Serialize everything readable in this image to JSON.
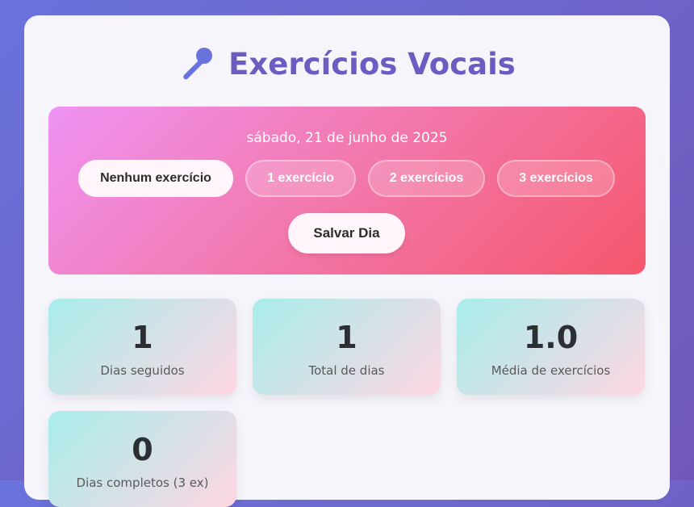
{
  "header": {
    "title": "Exercícios Vocais",
    "icon": "microphone-icon"
  },
  "today": {
    "date": "sábado, 21 de junho de 2025",
    "options": [
      "Nenhum exercício",
      "1 exercício",
      "2 exercícios",
      "3 exercícios"
    ],
    "selected_index": 0,
    "save_label": "Salvar Dia"
  },
  "stats": [
    {
      "value": "1",
      "label": "Dias seguidos"
    },
    {
      "value": "1",
      "label": "Total de dias"
    },
    {
      "value": "1.0",
      "label": "Média de exercícios"
    },
    {
      "value": "0",
      "label": "Dias completos (3 ex)"
    }
  ],
  "colors": {
    "accent": "#6a5cc0",
    "today_gradient": [
      "#f093f4",
      "#f5576c"
    ],
    "stat_gradient": [
      "#a8edea",
      "#fed6e3"
    ]
  }
}
